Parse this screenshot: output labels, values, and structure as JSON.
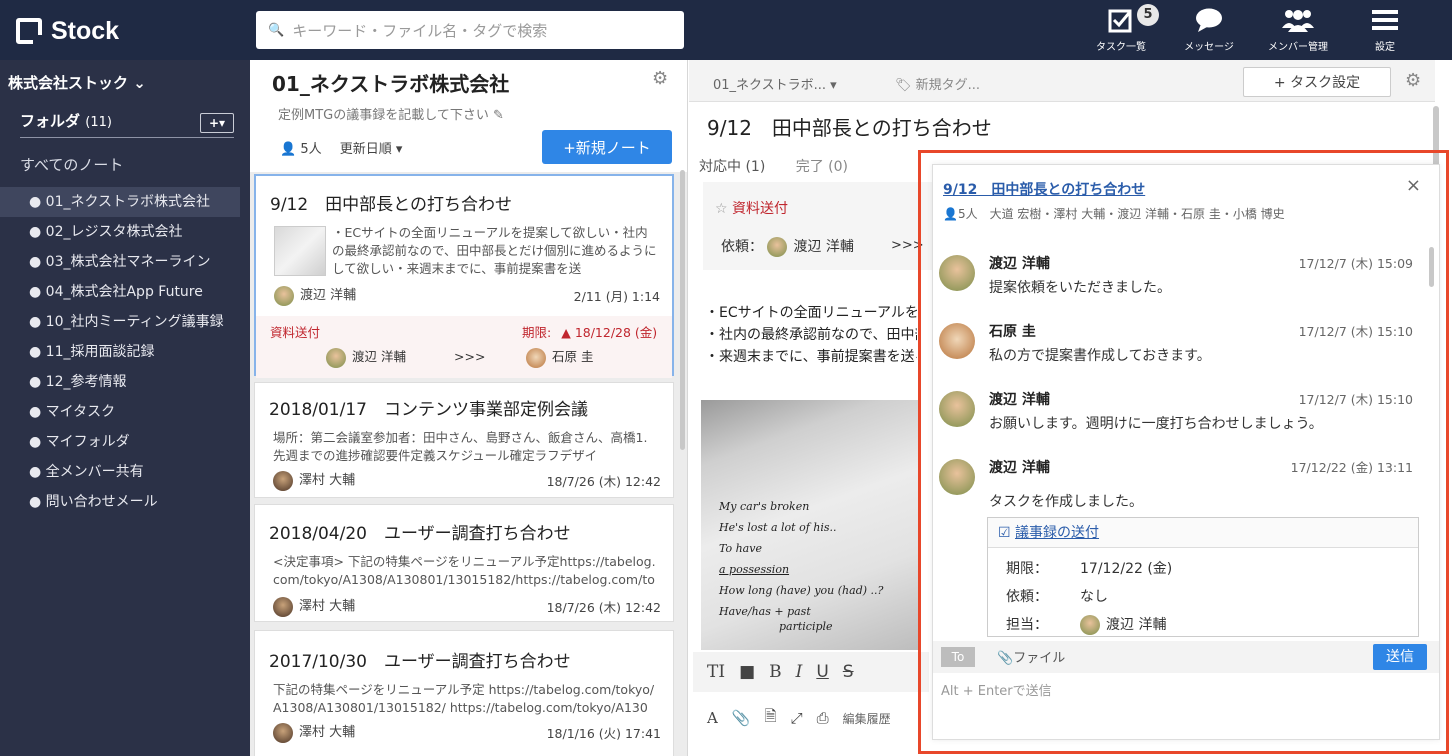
{
  "app": {
    "logo": "Stock"
  },
  "search": {
    "placeholder": "キーワード・ファイル名・タグで検索"
  },
  "topnav": {
    "tasks_label": "タスク一覧",
    "tasks_badge": "5",
    "messages_label": "メッセージ",
    "members_label": "メンバー管理",
    "settings_label": "設定"
  },
  "sidebar": {
    "company": "株式会社ストック",
    "folder_label": "フォルダ",
    "folder_count": "(11)",
    "add_label": "+▾",
    "all_notes": "すべてのノート",
    "items": [
      {
        "label": "● 01_ネクストラボ株式会社"
      },
      {
        "label": "● 02_レジスタ株式会社"
      },
      {
        "label": "● 03_株式会社マネーライン"
      },
      {
        "label": "● 04_株式会社App Future"
      },
      {
        "label": "● 10_社内ミーティング議事録"
      },
      {
        "label": "● 11_採用面談記録"
      },
      {
        "label": "● 12_参考情報"
      },
      {
        "label": "● マイタスク"
      },
      {
        "label": "● マイフォルダ"
      },
      {
        "label": "● 全メンバー共有"
      },
      {
        "label": "● 問い合わせメール"
      }
    ]
  },
  "notelist": {
    "title": "01_ネクストラボ株式会社",
    "description": "定例MTGの議事録を記載して下さい",
    "members": "5人",
    "sort": "更新日順 ▾",
    "new_note": "+新規ノート",
    "cards": [
      {
        "title": "9/12　田中部長との打ち合わせ",
        "snippet": "・ECサイトの全面リニューアルを提案して欲しい・社内の最終承認前なので、田中部長とだけ個別に進めるようにして欲しい・来週末までに、事前提案書を送",
        "author": "渡辺 洋輔",
        "date": "2/11 (月) 1:14",
        "task": "資料送付",
        "deadline_label": "期限:",
        "deadline": "18/12/28 (金)",
        "from": "渡辺 洋輔",
        "arrow": ">>>",
        "to": "石原 圭"
      },
      {
        "title": "2018/01/17　コンテンツ事業部定例会議",
        "snippet": "場所：第二会議室参加者：田中さん、島野さん、飯倉さん、高橋1. 先週までの進捗確認要件定義スケジュール確定ラフデザイ",
        "author": "澤村 大輔",
        "date": "18/7/26 (木) 12:42"
      },
      {
        "title": "2018/04/20　ユーザー調査打ち合わせ",
        "snippet": "<決定事項> 下記の特集ページをリニューアル予定https://tabelog.com/tokyo/A1308/A130801/13015182/https://tabelog.com/tok",
        "author": "澤村 大輔",
        "date": "18/7/26 (木) 12:42"
      },
      {
        "title": "2017/10/30　ユーザー調査打ち合わせ",
        "snippet": "下記の特集ページをリニューアル予定 https://tabelog.com/tokyo/A1308/A130801/13015182/ https://tabelog.com/tokyo/A1308/A",
        "author": "澤村 大輔",
        "date": "18/1/16 (火) 17:41"
      }
    ]
  },
  "editor": {
    "breadcrumb": "01_ネクストラボ... ▾",
    "tag": "新規タグ...",
    "task_settings": "+ タスク設定",
    "title": "9/12　田中部長との打ち合わせ",
    "tab_active": "対応中 (1)",
    "tab_done": "完了 (0)",
    "task_name": "資料送付",
    "requester_label": "依頼：",
    "requester": "渡辺 洋輔",
    "arrow": ">>>",
    "body": [
      "・ECサイトの全面リニューアルを提案して欲しい",
      "・社内の最終承認前なので、田中部長とだけ個別に進める",
      "・来週末までに、事前提案書を送る"
    ],
    "whiteboard": [
      "My car's broken",
      "He's lost a lot of his..",
      "To have",
      "a possession",
      "How long (have) you (had) ..?",
      "Have/has + past",
      "participle"
    ],
    "edit_label": "編集履歴"
  },
  "chat": {
    "title": "9/12　田中部長との打ち合わせ",
    "members": "5人　大道 宏樹・澤村 大輔・渡辺 洋輔・石原 圭・小橋 博史",
    "messages": [
      {
        "name": "渡辺 洋輔",
        "time": "17/12/7 (木) 15:09",
        "text": "提案依頼をいただきました。"
      },
      {
        "name": "石原 圭",
        "time": "17/12/7 (木) 15:10",
        "text": "私の方で提案書作成しておきます。"
      },
      {
        "name": "渡辺 洋輔",
        "time": "17/12/7 (木) 15:10",
        "text": "お願いします。週明けに一度打ち合わせしましょう。"
      },
      {
        "name": "渡辺 洋輔",
        "time": "17/12/22 (金) 13:11",
        "text": "タスクを作成しました。"
      }
    ],
    "task": {
      "title": "議事録の送付",
      "deadline_label": "期限：",
      "deadline": "17/12/22 (金)",
      "requester_label": "依頼：",
      "requester": "なし",
      "owner_label": "担当：",
      "owner": "渡辺 洋輔"
    },
    "to_label": "To",
    "file_label": "ファイル",
    "send_label": "送信",
    "input_placeholder": "Alt + Enterで送信"
  },
  "colors": {
    "header": "#1f2a44",
    "sidebar": "#2b3147",
    "accent": "#2f86e6",
    "highlight": "#e8472a"
  }
}
